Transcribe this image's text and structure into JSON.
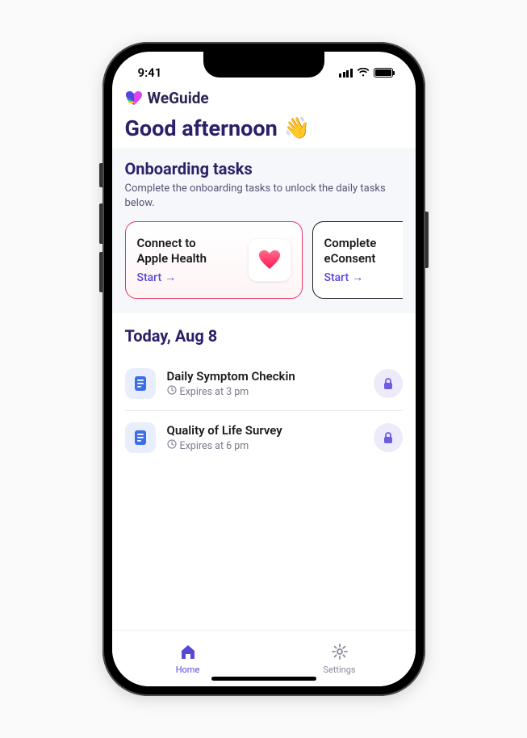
{
  "status": {
    "time": "9:41"
  },
  "brand": {
    "name": "WeGuide"
  },
  "greeting": {
    "text": "Good afternoon",
    "emoji": "👋"
  },
  "onboarding": {
    "title": "Onboarding tasks",
    "description": "Complete the onboarding tasks to unlock the daily tasks below.",
    "cards": [
      {
        "title_l1": "Connect to",
        "title_l2": "Apple Health",
        "action": "Start"
      },
      {
        "title_l1": "Complete",
        "title_l2": "eConsent",
        "action": "Start"
      }
    ]
  },
  "today": {
    "title": "Today, Aug 8",
    "tasks": [
      {
        "title": "Daily Symptom Checkin",
        "expires": "Expires at 3 pm"
      },
      {
        "title": "Quality of Life Survey",
        "expires": "Expires at 6 pm"
      }
    ]
  },
  "tabs": {
    "home": "Home",
    "settings": "Settings"
  }
}
